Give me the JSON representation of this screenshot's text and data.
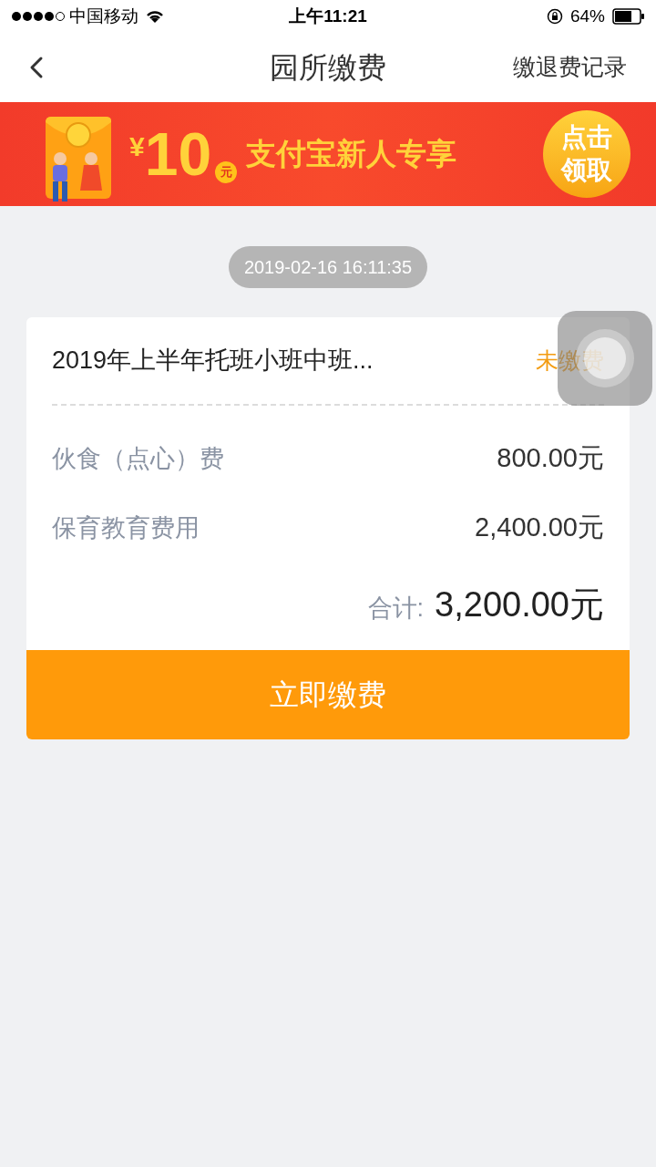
{
  "status_bar": {
    "carrier": "中国移动",
    "time": "上午11:21",
    "battery": "64%"
  },
  "nav": {
    "title": "园所缴费",
    "action": "缴退费记录"
  },
  "banner": {
    "currency": "¥",
    "amount": "10",
    "unit": "元",
    "slogan": "支付宝新人专享",
    "cta": "点击领取"
  },
  "timestamp": "2019-02-16 16:11:35",
  "bill": {
    "title": "2019年上半年托班小班中班...",
    "status": "未缴费",
    "items": [
      {
        "label": "伙食（点心）费",
        "amount": "800.00元"
      },
      {
        "label": "保育教育费用",
        "amount": "2,400.00元"
      }
    ],
    "total_label": "合计:",
    "total": "3,200.00元",
    "pay_button": "立即缴费"
  }
}
